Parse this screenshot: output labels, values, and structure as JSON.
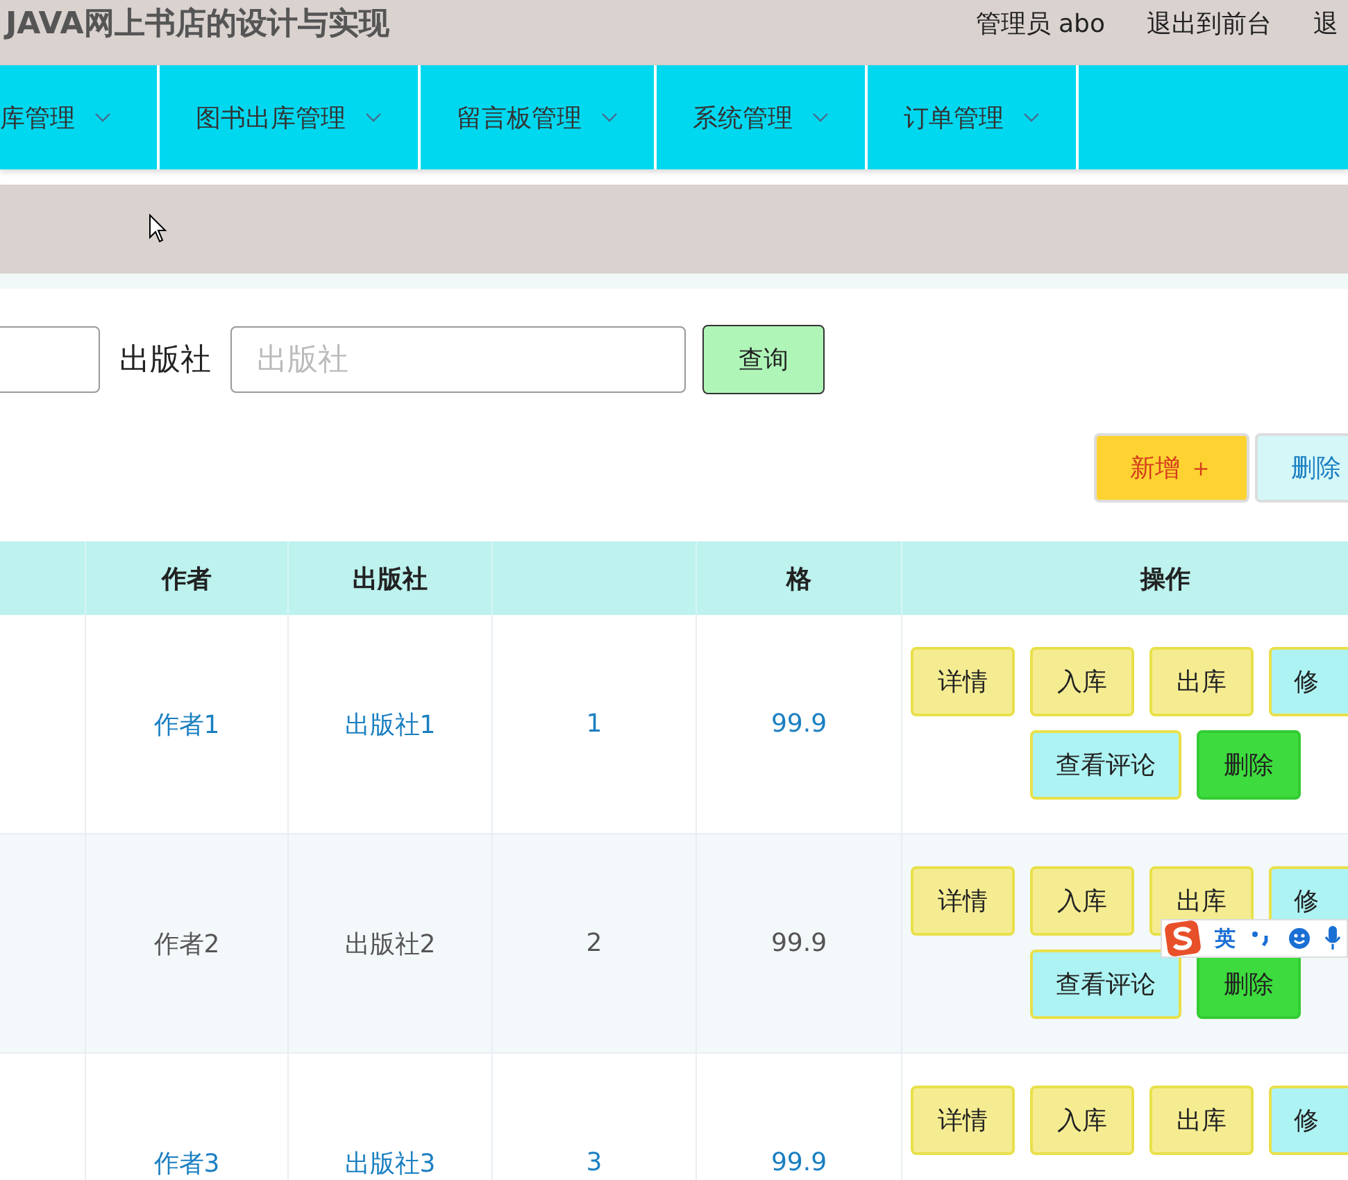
{
  "header": {
    "title": "JAVA网上书店的设计与实现",
    "links": [
      "管理员 abo",
      "退出到前台",
      "退"
    ]
  },
  "nav": [
    {
      "label": "库管理"
    },
    {
      "label": "图书出库管理"
    },
    {
      "label": "留言板管理"
    },
    {
      "label": "系统管理"
    },
    {
      "label": "订单管理"
    }
  ],
  "search": {
    "label": "出版社",
    "placeholder": "出版社",
    "button": "查询"
  },
  "toolbar": [
    {
      "label": "新增 ＋",
      "kind": "add"
    },
    {
      "label": "删除",
      "kind": "delete"
    }
  ],
  "table": {
    "columns": [
      "",
      "作者",
      "出版社",
      "",
      "格",
      "操作"
    ],
    "rows": [
      {
        "highlighted": false,
        "cells": [
          "",
          "作者1",
          "出版社1",
          "1",
          "99.9"
        ],
        "actions": [
          {
            "label": "详情",
            "kind": "warning"
          },
          {
            "label": "入库",
            "kind": "warning"
          },
          {
            "label": "出库",
            "kind": "warning"
          },
          {
            "label": "修",
            "kind": "info"
          },
          {
            "label": "查看评论",
            "kind": "info"
          },
          {
            "label": "删除",
            "kind": "success"
          }
        ]
      },
      {
        "highlighted": true,
        "cells": [
          "",
          "作者2",
          "出版社2",
          "2",
          "99.9"
        ],
        "actions": [
          {
            "label": "详情",
            "kind": "warning"
          },
          {
            "label": "入库",
            "kind": "warning"
          },
          {
            "label": "出库",
            "kind": "warning"
          },
          {
            "label": "修",
            "kind": "info"
          },
          {
            "label": "查看评论",
            "kind": "info"
          },
          {
            "label": "删除",
            "kind": "success"
          }
        ]
      },
      {
        "highlighted": false,
        "cells": [
          "",
          "作者3",
          "出版社3",
          "3",
          "99.9"
        ],
        "actions": [
          {
            "label": "详情",
            "kind": "warning"
          },
          {
            "label": "入库",
            "kind": "warning"
          },
          {
            "label": "出库",
            "kind": "warning"
          },
          {
            "label": "修",
            "kind": "info"
          }
        ]
      }
    ]
  },
  "ime": {
    "mode": "英"
  }
}
